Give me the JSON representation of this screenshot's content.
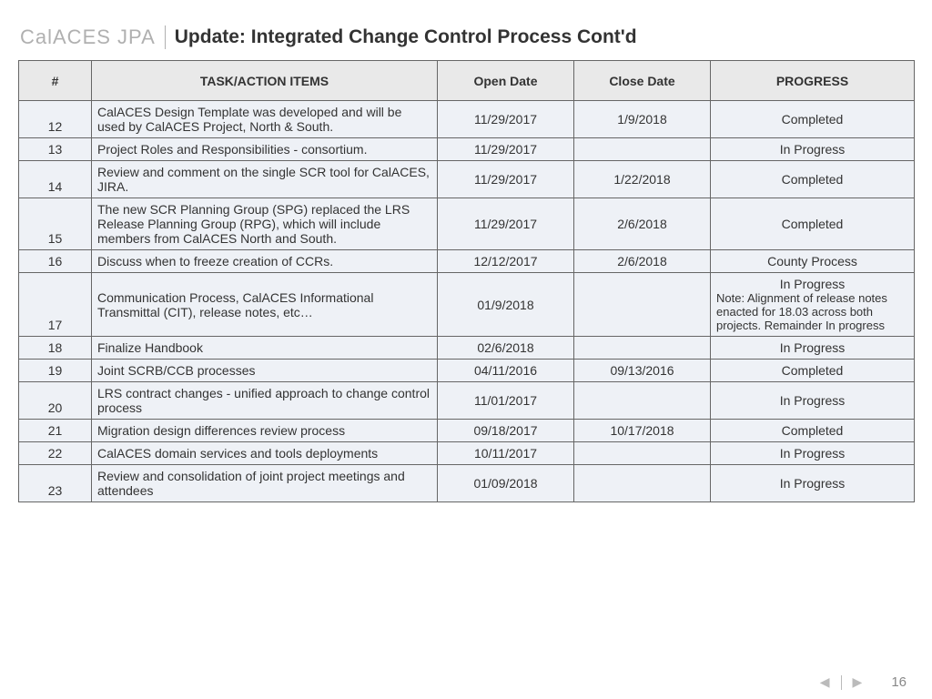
{
  "header": {
    "brand": "CalACES JPA",
    "title": "Update: Integrated Change Control Process Cont'd"
  },
  "columns": {
    "num": "#",
    "task": "TASK/ACTION ITEMS",
    "open": "Open Date",
    "close": "Close Date",
    "progress": "PROGRESS"
  },
  "rows": [
    {
      "num": "12",
      "task": "CalACES Design Template was developed and will be used by CalACES Project, North &  South.",
      "open": "11/29/2017",
      "close": "1/9/2018",
      "progress": "Completed"
    },
    {
      "num": "13",
      "task": "Project Roles and Responsibilities - consortium.",
      "open": "11/29/2017",
      "close": "",
      "progress": "In Progress"
    },
    {
      "num": "14",
      "task": "Review and comment on the single SCR  tool for CalACES, JIRA.",
      "open": "11/29/2017",
      "close": "1/22/2018",
      "progress": "Completed"
    },
    {
      "num": "15",
      "task": "The new  SCR Planning Group (SPG) replaced the LRS Release Planning Group (RPG), which will include members from CalACES North and South.",
      "open": "11/29/2017",
      "close": "2/6/2018",
      "progress": "Completed"
    },
    {
      "num": "16",
      "task": "Discuss when to freeze creation of CCRs.",
      "open": "12/12/2017",
      "close": "2/6/2018",
      "progress": "County Process"
    },
    {
      "num": "17",
      "task": "Communication Process, CalACES Informational Transmittal (CIT), release notes, etc…",
      "open": "01/9/2018",
      "close": "",
      "progress": "In Progress",
      "note": "Note: Alignment of release notes enacted for 18.03 across both projects. Remainder In progress"
    },
    {
      "num": "18",
      "task": "Finalize Handbook",
      "open": "02/6/2018",
      "close": "",
      "progress": "In Progress"
    },
    {
      "num": "19",
      "task": "Joint SCRB/CCB processes",
      "open": "04/11/2016",
      "close": "09/13/2016",
      "progress": "Completed"
    },
    {
      "num": "20",
      "task": "LRS contract changes - unified approach to change control process",
      "open": "11/01/2017",
      "close": "",
      "progress": "In Progress"
    },
    {
      "num": "21",
      "task": "Migration design differences review process",
      "open": "09/18/2017",
      "close": "10/17/2018",
      "progress": "Completed"
    },
    {
      "num": "22",
      "task": "CalACES domain services and tools deployments",
      "open": "10/11/2017",
      "close": "",
      "progress": "In Progress"
    },
    {
      "num": "23",
      "task": "Review and consolidation of joint project meetings and attendees",
      "open": "01/09/2018",
      "close": "",
      "progress": "In Progress"
    }
  ],
  "footer": {
    "page": "16",
    "prev": "◀",
    "next": "▶"
  }
}
